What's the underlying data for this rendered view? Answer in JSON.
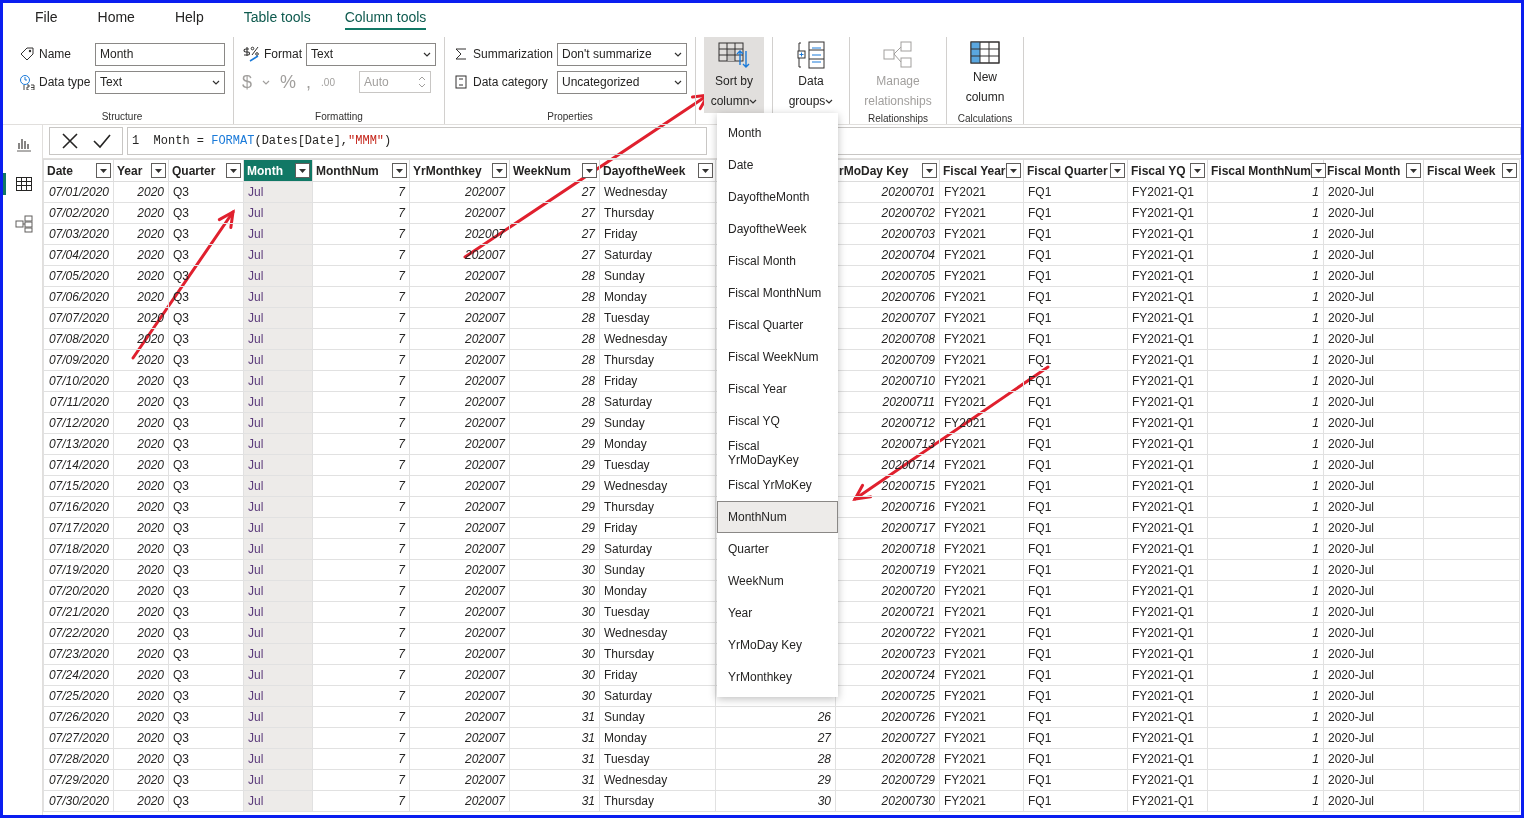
{
  "ribbon_tabs": [
    {
      "label": "File",
      "kind": "plain",
      "selected": false
    },
    {
      "label": "Home",
      "kind": "plain",
      "selected": false
    },
    {
      "label": "Help",
      "kind": "plain",
      "selected": false
    },
    {
      "label": "Table tools",
      "kind": "contextual",
      "selected": false
    },
    {
      "label": "Column tools",
      "kind": "contextual",
      "selected": true
    }
  ],
  "ribbon": {
    "structure": {
      "name_label": "Name",
      "name_value": "Month",
      "datatype_label": "Data type",
      "datatype_value": "Text",
      "group_label": "Structure"
    },
    "formatting": {
      "format_label": "Format",
      "format_value": "Text",
      "currency": "$",
      "percent": "%",
      "comma": ",",
      "decimals": ".00",
      "auto_value": "Auto",
      "disabled": true,
      "group_label": "Formatting"
    },
    "properties": {
      "summarization_label": "Summarization",
      "summarization_value": "Don't summarize",
      "category_label": "Data category",
      "category_value": "Uncategorized",
      "group_label": "Properties"
    },
    "sort_by_column": {
      "line1": "Sort by",
      "line2": "column",
      "pressed": true
    },
    "data_groups": {
      "line1": "Data",
      "line2": "groups"
    },
    "relationships": {
      "line1": "Manage",
      "line2": "relationships",
      "disabled": true,
      "group_label": "Relationships"
    },
    "new_column": {
      "line1": "New",
      "line2": "column",
      "group_label": "Calculations"
    }
  },
  "left_nav": [
    {
      "kind": "report",
      "selected": false
    },
    {
      "kind": "data",
      "selected": true
    },
    {
      "kind": "model",
      "selected": false
    }
  ],
  "formula_bar": {
    "line_number": "1",
    "tokens": [
      {
        "kind": "plain",
        "text": "Month = "
      },
      {
        "kind": "function",
        "text": "FORMAT"
      },
      {
        "kind": "plain",
        "text": "(Dates[Date],"
      },
      {
        "kind": "string",
        "text": "\"MMM\""
      },
      {
        "kind": "plain",
        "text": ")"
      }
    ]
  },
  "table": {
    "columns": [
      {
        "label": "Date",
        "kind": "number",
        "selected": false
      },
      {
        "label": "Year",
        "kind": "number",
        "selected": false
      },
      {
        "label": "Quarter",
        "kind": "text",
        "selected": false
      },
      {
        "label": "Month",
        "kind": "text",
        "selected": true
      },
      {
        "label": "MonthNum",
        "kind": "number",
        "selected": false
      },
      {
        "label": "YrMonthkey",
        "kind": "number",
        "selected": false
      },
      {
        "label": "WeekNum",
        "kind": "number",
        "selected": false
      },
      {
        "label": "DayoftheWeek",
        "kind": "text",
        "selected": false
      },
      {
        "kind": "number",
        "selected": false
      },
      {
        "label": "rMoDay Key",
        "kind": "number",
        "selected": false
      },
      {
        "label": "Fiscal Year",
        "kind": "text",
        "selected": false
      },
      {
        "label": "Fiscal Quarter",
        "kind": "text",
        "selected": false
      },
      {
        "label": "Fiscal YQ",
        "kind": "text",
        "selected": false
      },
      {
        "label": "Fiscal MonthNum",
        "kind": "number",
        "selected": false
      },
      {
        "label": "Fiscal Month",
        "kind": "text",
        "selected": false
      },
      {
        "label": "Fiscal Week",
        "kind": "text",
        "selected": false
      }
    ],
    "rows": [
      [
        "07/01/2020",
        "2020",
        "Q3",
        "Jul",
        "7",
        "202007",
        "27",
        "Wednesday",
        null,
        "20200701",
        "FY2021",
        "FQ1",
        "FY2021-Q1",
        "1",
        "2020-Jul",
        null
      ],
      [
        "07/02/2020",
        "2020",
        "Q3",
        "Jul",
        "7",
        "202007",
        "27",
        "Thursday",
        null,
        "20200702",
        "FY2021",
        "FQ1",
        "FY2021-Q1",
        "1",
        "2020-Jul",
        null
      ],
      [
        "07/03/2020",
        "2020",
        "Q3",
        "Jul",
        "7",
        "202007",
        "27",
        "Friday",
        null,
        "20200703",
        "FY2021",
        "FQ1",
        "FY2021-Q1",
        "1",
        "2020-Jul",
        null
      ],
      [
        "07/04/2020",
        "2020",
        "Q3",
        "Jul",
        "7",
        "202007",
        "27",
        "Saturday",
        null,
        "20200704",
        "FY2021",
        "FQ1",
        "FY2021-Q1",
        "1",
        "2020-Jul",
        null
      ],
      [
        "07/05/2020",
        "2020",
        "Q3",
        "Jul",
        "7",
        "202007",
        "28",
        "Sunday",
        null,
        "20200705",
        "FY2021",
        "FQ1",
        "FY2021-Q1",
        "1",
        "2020-Jul",
        null
      ],
      [
        "07/06/2020",
        "2020",
        "Q3",
        "Jul",
        "7",
        "202007",
        "28",
        "Monday",
        null,
        "20200706",
        "FY2021",
        "FQ1",
        "FY2021-Q1",
        "1",
        "2020-Jul",
        null
      ],
      [
        "07/07/2020",
        "2020",
        "Q3",
        "Jul",
        "7",
        "202007",
        "28",
        "Tuesday",
        null,
        "20200707",
        "FY2021",
        "FQ1",
        "FY2021-Q1",
        "1",
        "2020-Jul",
        null
      ],
      [
        "07/08/2020",
        "2020",
        "Q3",
        "Jul",
        "7",
        "202007",
        "28",
        "Wednesday",
        null,
        "20200708",
        "FY2021",
        "FQ1",
        "FY2021-Q1",
        "1",
        "2020-Jul",
        null
      ],
      [
        "07/09/2020",
        "2020",
        "Q3",
        "Jul",
        "7",
        "202007",
        "28",
        "Thursday",
        null,
        "20200709",
        "FY2021",
        "FQ1",
        "FY2021-Q1",
        "1",
        "2020-Jul",
        null
      ],
      [
        "07/10/2020",
        "2020",
        "Q3",
        "Jul",
        "7",
        "202007",
        "28",
        "Friday",
        null,
        "20200710",
        "FY2021",
        "FQ1",
        "FY2021-Q1",
        "1",
        "2020-Jul",
        null
      ],
      [
        "07/11/2020",
        "2020",
        "Q3",
        "Jul",
        "7",
        "202007",
        "28",
        "Saturday",
        null,
        "20200711",
        "FY2021",
        "FQ1",
        "FY2021-Q1",
        "1",
        "2020-Jul",
        null
      ],
      [
        "07/12/2020",
        "2020",
        "Q3",
        "Jul",
        "7",
        "202007",
        "29",
        "Sunday",
        null,
        "20200712",
        "FY2021",
        "FQ1",
        "FY2021-Q1",
        "1",
        "2020-Jul",
        null
      ],
      [
        "07/13/2020",
        "2020",
        "Q3",
        "Jul",
        "7",
        "202007",
        "29",
        "Monday",
        null,
        "20200713",
        "FY2021",
        "FQ1",
        "FY2021-Q1",
        "1",
        "2020-Jul",
        null
      ],
      [
        "07/14/2020",
        "2020",
        "Q3",
        "Jul",
        "7",
        "202007",
        "29",
        "Tuesday",
        null,
        "20200714",
        "FY2021",
        "FQ1",
        "FY2021-Q1",
        "1",
        "2020-Jul",
        null
      ],
      [
        "07/15/2020",
        "2020",
        "Q3",
        "Jul",
        "7",
        "202007",
        "29",
        "Wednesday",
        null,
        "20200715",
        "FY2021",
        "FQ1",
        "FY2021-Q1",
        "1",
        "2020-Jul",
        null
      ],
      [
        "07/16/2020",
        "2020",
        "Q3",
        "Jul",
        "7",
        "202007",
        "29",
        "Thursday",
        null,
        "20200716",
        "FY2021",
        "FQ1",
        "FY2021-Q1",
        "1",
        "2020-Jul",
        null
      ],
      [
        "07/17/2020",
        "2020",
        "Q3",
        "Jul",
        "7",
        "202007",
        "29",
        "Friday",
        null,
        "20200717",
        "FY2021",
        "FQ1",
        "FY2021-Q1",
        "1",
        "2020-Jul",
        null
      ],
      [
        "07/18/2020",
        "2020",
        "Q3",
        "Jul",
        "7",
        "202007",
        "29",
        "Saturday",
        null,
        "20200718",
        "FY2021",
        "FQ1",
        "FY2021-Q1",
        "1",
        "2020-Jul",
        null
      ],
      [
        "07/19/2020",
        "2020",
        "Q3",
        "Jul",
        "7",
        "202007",
        "30",
        "Sunday",
        null,
        "20200719",
        "FY2021",
        "FQ1",
        "FY2021-Q1",
        "1",
        "2020-Jul",
        null
      ],
      [
        "07/20/2020",
        "2020",
        "Q3",
        "Jul",
        "7",
        "202007",
        "30",
        "Monday",
        null,
        "20200720",
        "FY2021",
        "FQ1",
        "FY2021-Q1",
        "1",
        "2020-Jul",
        null
      ],
      [
        "07/21/2020",
        "2020",
        "Q3",
        "Jul",
        "7",
        "202007",
        "30",
        "Tuesday",
        null,
        "20200721",
        "FY2021",
        "FQ1",
        "FY2021-Q1",
        "1",
        "2020-Jul",
        null
      ],
      [
        "07/22/2020",
        "2020",
        "Q3",
        "Jul",
        "7",
        "202007",
        "30",
        "Wednesday",
        null,
        "20200722",
        "FY2021",
        "FQ1",
        "FY2021-Q1",
        "1",
        "2020-Jul",
        null
      ],
      [
        "07/23/2020",
        "2020",
        "Q3",
        "Jul",
        "7",
        "202007",
        "30",
        "Thursday",
        null,
        "20200723",
        "FY2021",
        "FQ1",
        "FY2021-Q1",
        "1",
        "2020-Jul",
        null
      ],
      [
        "07/24/2020",
        "2020",
        "Q3",
        "Jul",
        "7",
        "202007",
        "30",
        "Friday",
        null,
        "20200724",
        "FY2021",
        "FQ1",
        "FY2021-Q1",
        "1",
        "2020-Jul",
        null
      ],
      [
        "07/25/2020",
        "2020",
        "Q3",
        "Jul",
        "7",
        "202007",
        "30",
        "Saturday",
        null,
        "20200725",
        "FY2021",
        "FQ1",
        "FY2021-Q1",
        "1",
        "2020-Jul",
        null
      ],
      [
        "07/26/2020",
        "2020",
        "Q3",
        "Jul",
        "7",
        "202007",
        "31",
        "Sunday",
        "26",
        "20200726",
        "FY2021",
        "FQ1",
        "FY2021-Q1",
        "1",
        "2020-Jul",
        null
      ],
      [
        "07/27/2020",
        "2020",
        "Q3",
        "Jul",
        "7",
        "202007",
        "31",
        "Monday",
        "27",
        "20200727",
        "FY2021",
        "FQ1",
        "FY2021-Q1",
        "1",
        "2020-Jul",
        null
      ],
      [
        "07/28/2020",
        "2020",
        "Q3",
        "Jul",
        "7",
        "202007",
        "31",
        "Tuesday",
        "28",
        "20200728",
        "FY2021",
        "FQ1",
        "FY2021-Q1",
        "1",
        "2020-Jul",
        null
      ],
      [
        "07/29/2020",
        "2020",
        "Q3",
        "Jul",
        "7",
        "202007",
        "31",
        "Wednesday",
        "29",
        "20200729",
        "FY2021",
        "FQ1",
        "FY2021-Q1",
        "1",
        "2020-Jul",
        null
      ],
      [
        "07/30/2020",
        "2020",
        "Q3",
        "Jul",
        "7",
        "202007",
        "31",
        "Thursday",
        "30",
        "20200730",
        "FY2021",
        "FQ1",
        "FY2021-Q1",
        "1",
        "2020-Jul",
        null
      ]
    ]
  },
  "sort_menu": {
    "items": [
      {
        "label": "Month",
        "selected": false
      },
      {
        "label": "Date",
        "selected": false
      },
      {
        "label": "DayoftheMonth",
        "selected": false
      },
      {
        "label": "DayoftheWeek",
        "selected": false
      },
      {
        "label": "Fiscal Month",
        "selected": false
      },
      {
        "label": "Fiscal MonthNum",
        "selected": false
      },
      {
        "label": "Fiscal Quarter",
        "selected": false
      },
      {
        "label": "Fiscal WeekNum",
        "selected": false
      },
      {
        "label": "Fiscal Year",
        "selected": false
      },
      {
        "label": "Fiscal YQ",
        "selected": false
      },
      {
        "label": "Fiscal YrMoDayKey",
        "selected": false
      },
      {
        "label": "Fiscal YrMoKey",
        "selected": false
      },
      {
        "label": "MonthNum",
        "selected": true
      },
      {
        "label": "Quarter",
        "selected": false
      },
      {
        "label": "WeekNum",
        "selected": false
      },
      {
        "label": "Year",
        "selected": false
      },
      {
        "label": "YrMoDay Key",
        "selected": false
      },
      {
        "label": "YrMonthkey",
        "selected": false
      }
    ]
  }
}
